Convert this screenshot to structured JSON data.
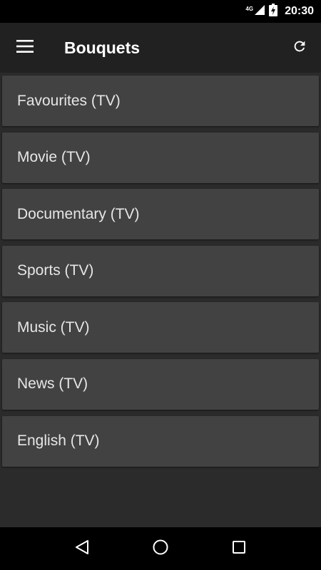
{
  "status": {
    "network": "4G",
    "time": "20:30",
    "icons": [
      "signal-icon",
      "battery-charging-icon"
    ]
  },
  "app_bar": {
    "title": "Bouquets",
    "icons": [
      "menu-icon",
      "refresh-icon"
    ]
  },
  "bouquets": [
    {
      "label": "Favourites (TV)"
    },
    {
      "label": "Movie (TV)"
    },
    {
      "label": "Documentary (TV)"
    },
    {
      "label": "Sports (TV)"
    },
    {
      "label": "Music (TV)"
    },
    {
      "label": "News (TV)"
    },
    {
      "label": "English (TV)"
    }
  ],
  "nav": {
    "icons": [
      "back-icon",
      "home-icon",
      "recents-icon"
    ]
  },
  "colors": {
    "app_bar": "#212121",
    "background": "#2b2b2b",
    "card": "#424242",
    "text": "#e6e6e6"
  }
}
